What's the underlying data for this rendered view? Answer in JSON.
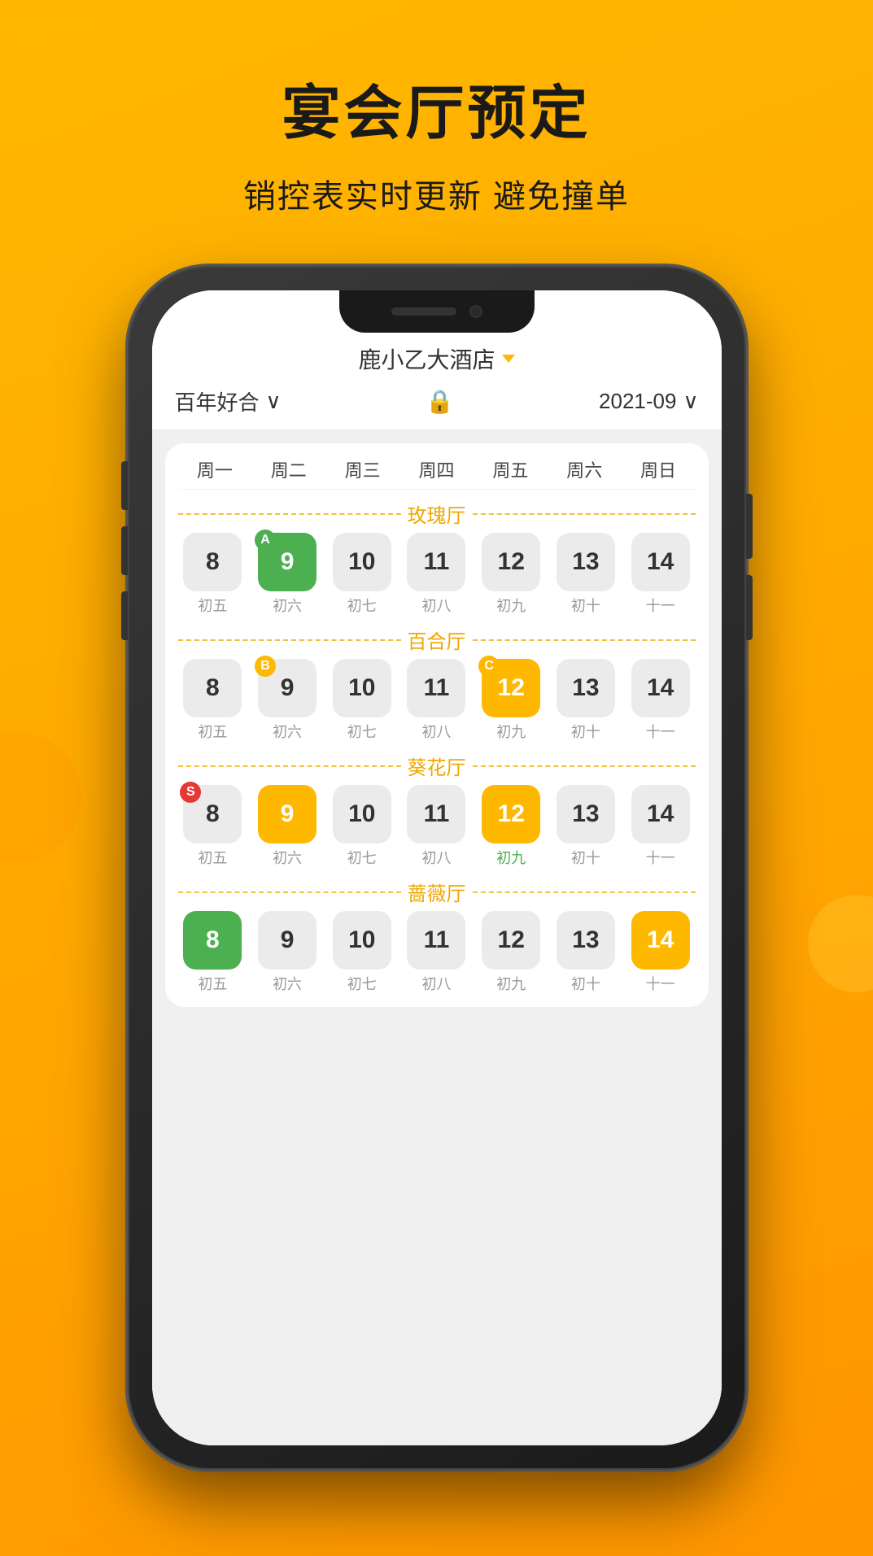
{
  "app": {
    "title": "宴会厅预定",
    "subtitle": "销控表实时更新  避免撞单"
  },
  "header": {
    "hotel_name": "鹿小乙大酒店",
    "hotel_chevron": "▼",
    "hall_filter": "百年好合",
    "hall_chevron": "∨",
    "date": "2021-09",
    "date_chevron": "∨",
    "lock_icon": "🔒"
  },
  "weekdays": [
    "周一",
    "周二",
    "周三",
    "周四",
    "周五",
    "周六",
    "周日"
  ],
  "halls": [
    {
      "name": "玫瑰厅",
      "dates": [
        {
          "num": "8",
          "lunar": "初五",
          "style": "normal",
          "badge": null
        },
        {
          "num": "9",
          "lunar": "初六",
          "style": "green",
          "badge": "A"
        },
        {
          "num": "10",
          "lunar": "初七",
          "style": "normal",
          "badge": null
        },
        {
          "num": "11",
          "lunar": "初八",
          "style": "normal",
          "badge": null
        },
        {
          "num": "12",
          "lunar": "初九",
          "style": "normal",
          "badge": null
        },
        {
          "num": "13",
          "lunar": "初十",
          "style": "normal",
          "badge": null
        },
        {
          "num": "14",
          "lunar": "十一",
          "style": "normal",
          "badge": null
        }
      ]
    },
    {
      "name": "百合厅",
      "dates": [
        {
          "num": "8",
          "lunar": "初五",
          "style": "normal",
          "badge": null
        },
        {
          "num": "9",
          "lunar": "初六",
          "style": "normal",
          "badge": "B"
        },
        {
          "num": "10",
          "lunar": "初七",
          "style": "normal",
          "badge": null
        },
        {
          "num": "11",
          "lunar": "初八",
          "style": "normal",
          "badge": null
        },
        {
          "num": "12",
          "lunar": "初九",
          "style": "yellow",
          "badge": "C"
        },
        {
          "num": "13",
          "lunar": "初十",
          "style": "normal",
          "badge": null
        },
        {
          "num": "14",
          "lunar": "十一",
          "style": "normal",
          "badge": null
        }
      ]
    },
    {
      "name": "葵花厅",
      "dates": [
        {
          "num": "8",
          "lunar": "初五",
          "style": "normal",
          "badge": "S"
        },
        {
          "num": "9",
          "lunar": "初六",
          "style": "yellow",
          "badge": null
        },
        {
          "num": "10",
          "lunar": "初七",
          "style": "normal",
          "badge": null
        },
        {
          "num": "11",
          "lunar": "初八",
          "style": "normal",
          "badge": null
        },
        {
          "num": "12",
          "lunar": "初九",
          "style": "yellow",
          "badge": null
        },
        {
          "num": "13",
          "lunar": "初十",
          "style": "normal",
          "badge": null
        },
        {
          "num": "14",
          "lunar": "十一",
          "style": "normal",
          "badge": null
        }
      ],
      "lunar_override": [
        {
          "lunar": "初五",
          "style": "normal"
        },
        {
          "lunar": "初六",
          "style": "normal"
        },
        {
          "lunar": "初七",
          "style": "normal"
        },
        {
          "lunar": "初八",
          "style": "normal"
        },
        {
          "lunar": "初九",
          "style": "green-text"
        },
        {
          "lunar": "初十",
          "style": "normal"
        },
        {
          "lunar": "十一",
          "style": "normal"
        }
      ]
    },
    {
      "name": "蔷薇厅",
      "dates": [
        {
          "num": "8",
          "lunar": "初五",
          "style": "green",
          "badge": null
        },
        {
          "num": "9",
          "lunar": "初六",
          "style": "normal",
          "badge": null
        },
        {
          "num": "10",
          "lunar": "初七",
          "style": "normal",
          "badge": null
        },
        {
          "num": "11",
          "lunar": "初八",
          "style": "normal",
          "badge": null
        },
        {
          "num": "12",
          "lunar": "初九",
          "style": "normal",
          "badge": null
        },
        {
          "num": "13",
          "lunar": "初十",
          "style": "normal",
          "badge": null
        },
        {
          "num": "14",
          "lunar": "十一",
          "style": "yellow",
          "badge": null
        }
      ]
    }
  ],
  "badge_colors": {
    "A": "green",
    "B": "yellow",
    "C": "yellow",
    "S": "red"
  }
}
